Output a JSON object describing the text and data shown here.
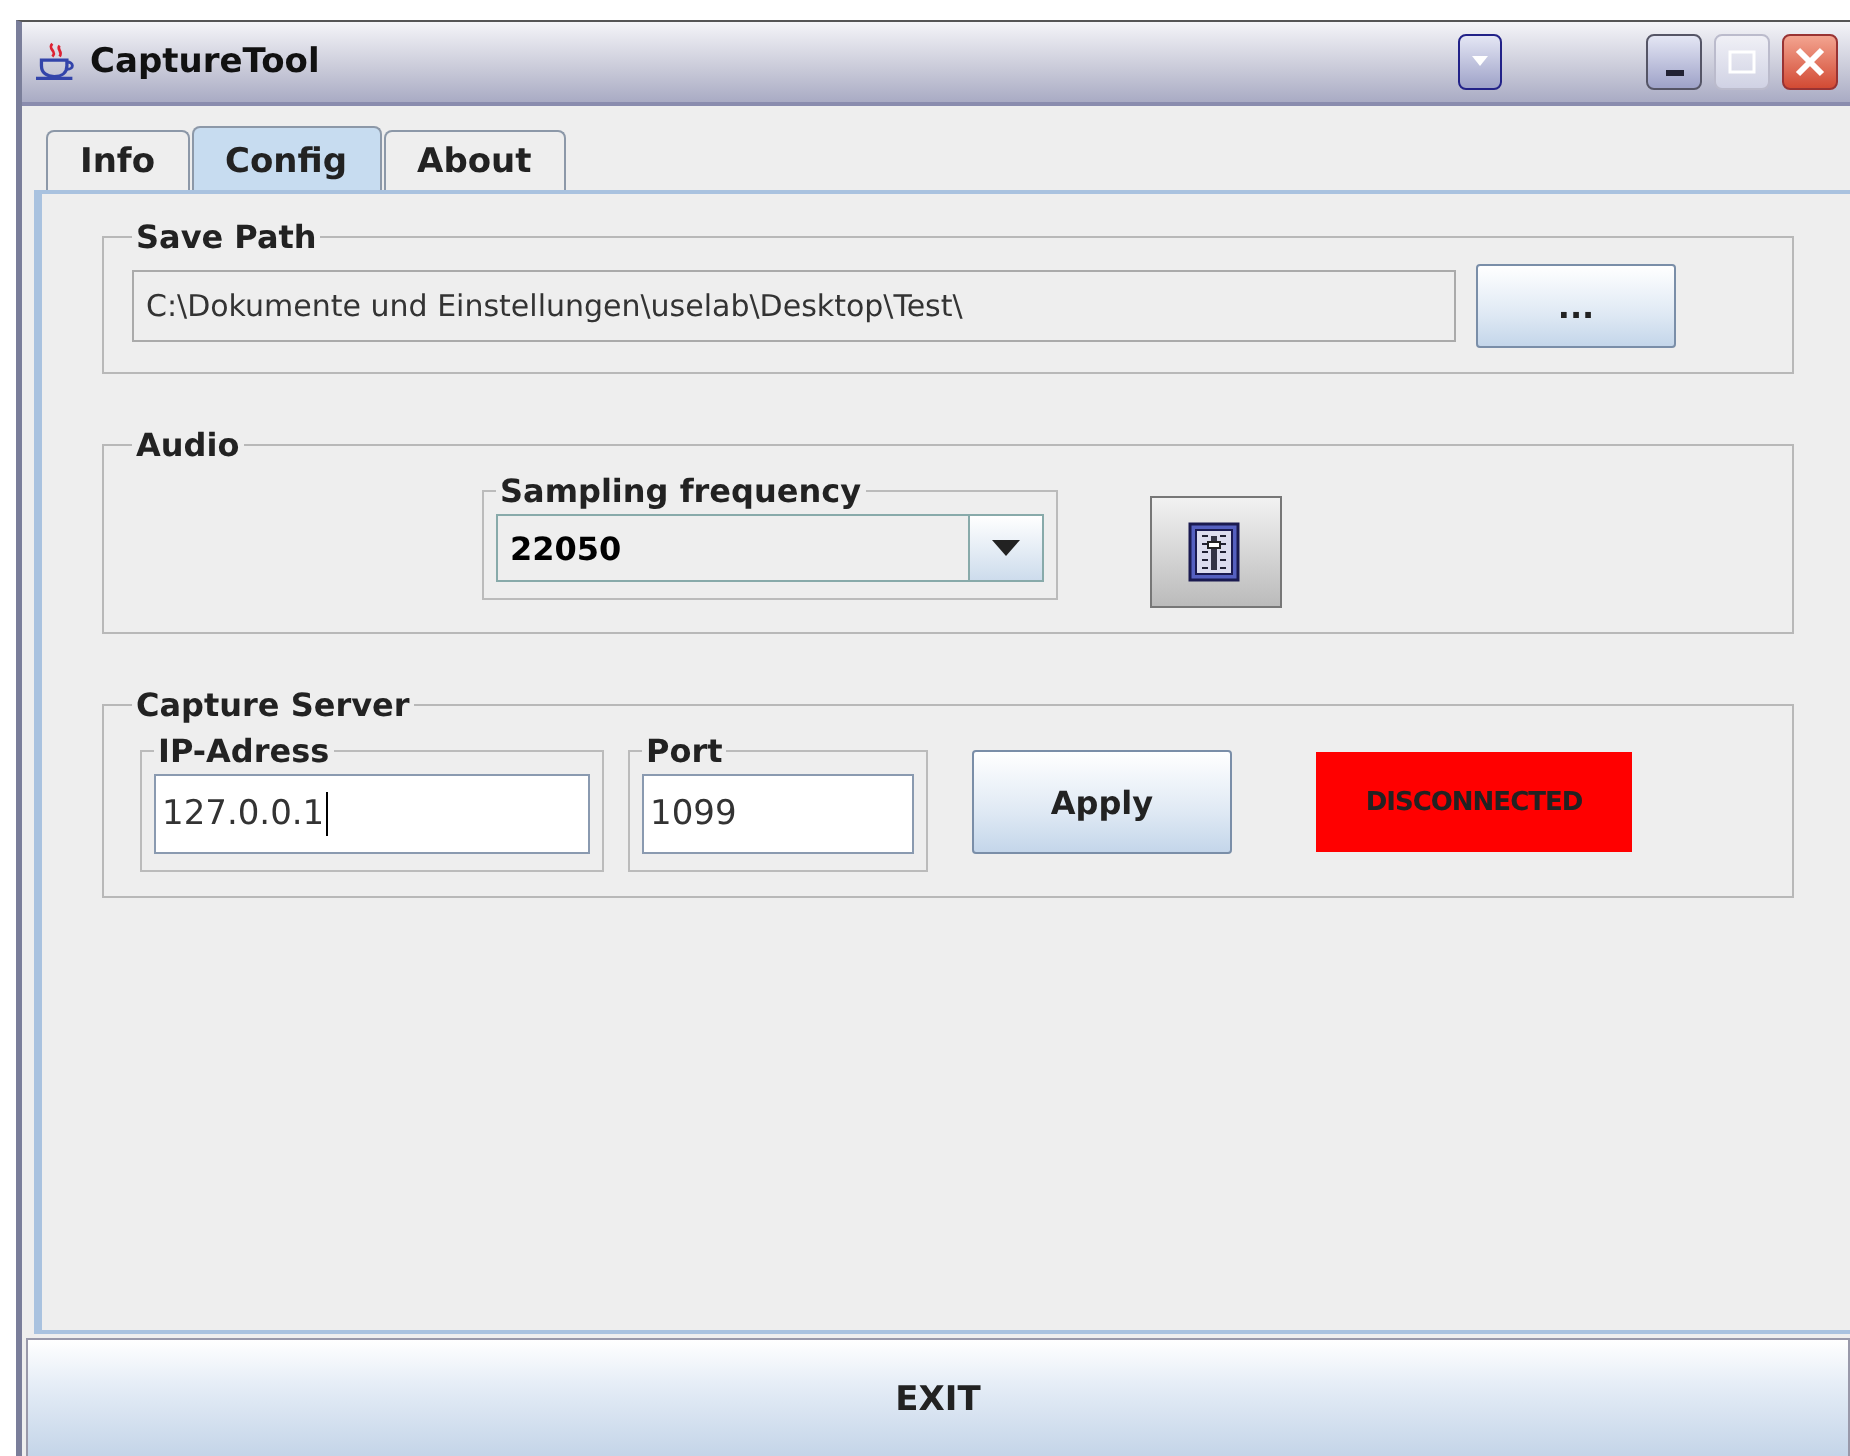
{
  "window": {
    "title": "CaptureTool"
  },
  "tabs": [
    {
      "label": "Info",
      "selected": false
    },
    {
      "label": "Config",
      "selected": true
    },
    {
      "label": "About",
      "selected": false
    }
  ],
  "save_path": {
    "title": "Save Path",
    "value": "C:\\Dokumente und Einstellungen\\uselab\\Desktop\\Test\\",
    "disabled": true,
    "browse_button": "..."
  },
  "audio": {
    "title": "Audio",
    "sampling": {
      "title": "Sampling frequency",
      "value": "22050"
    }
  },
  "capture_server": {
    "title": "Capture Server",
    "ip": {
      "title": "IP-Adress",
      "value": "127.0.0.1",
      "focused": true
    },
    "port": {
      "title": "Port",
      "value": "1099",
      "focused": false
    },
    "apply_button": "Apply",
    "status": {
      "text": "DISCONNECTED",
      "connected": false
    }
  },
  "exit_button": "EXIT"
}
